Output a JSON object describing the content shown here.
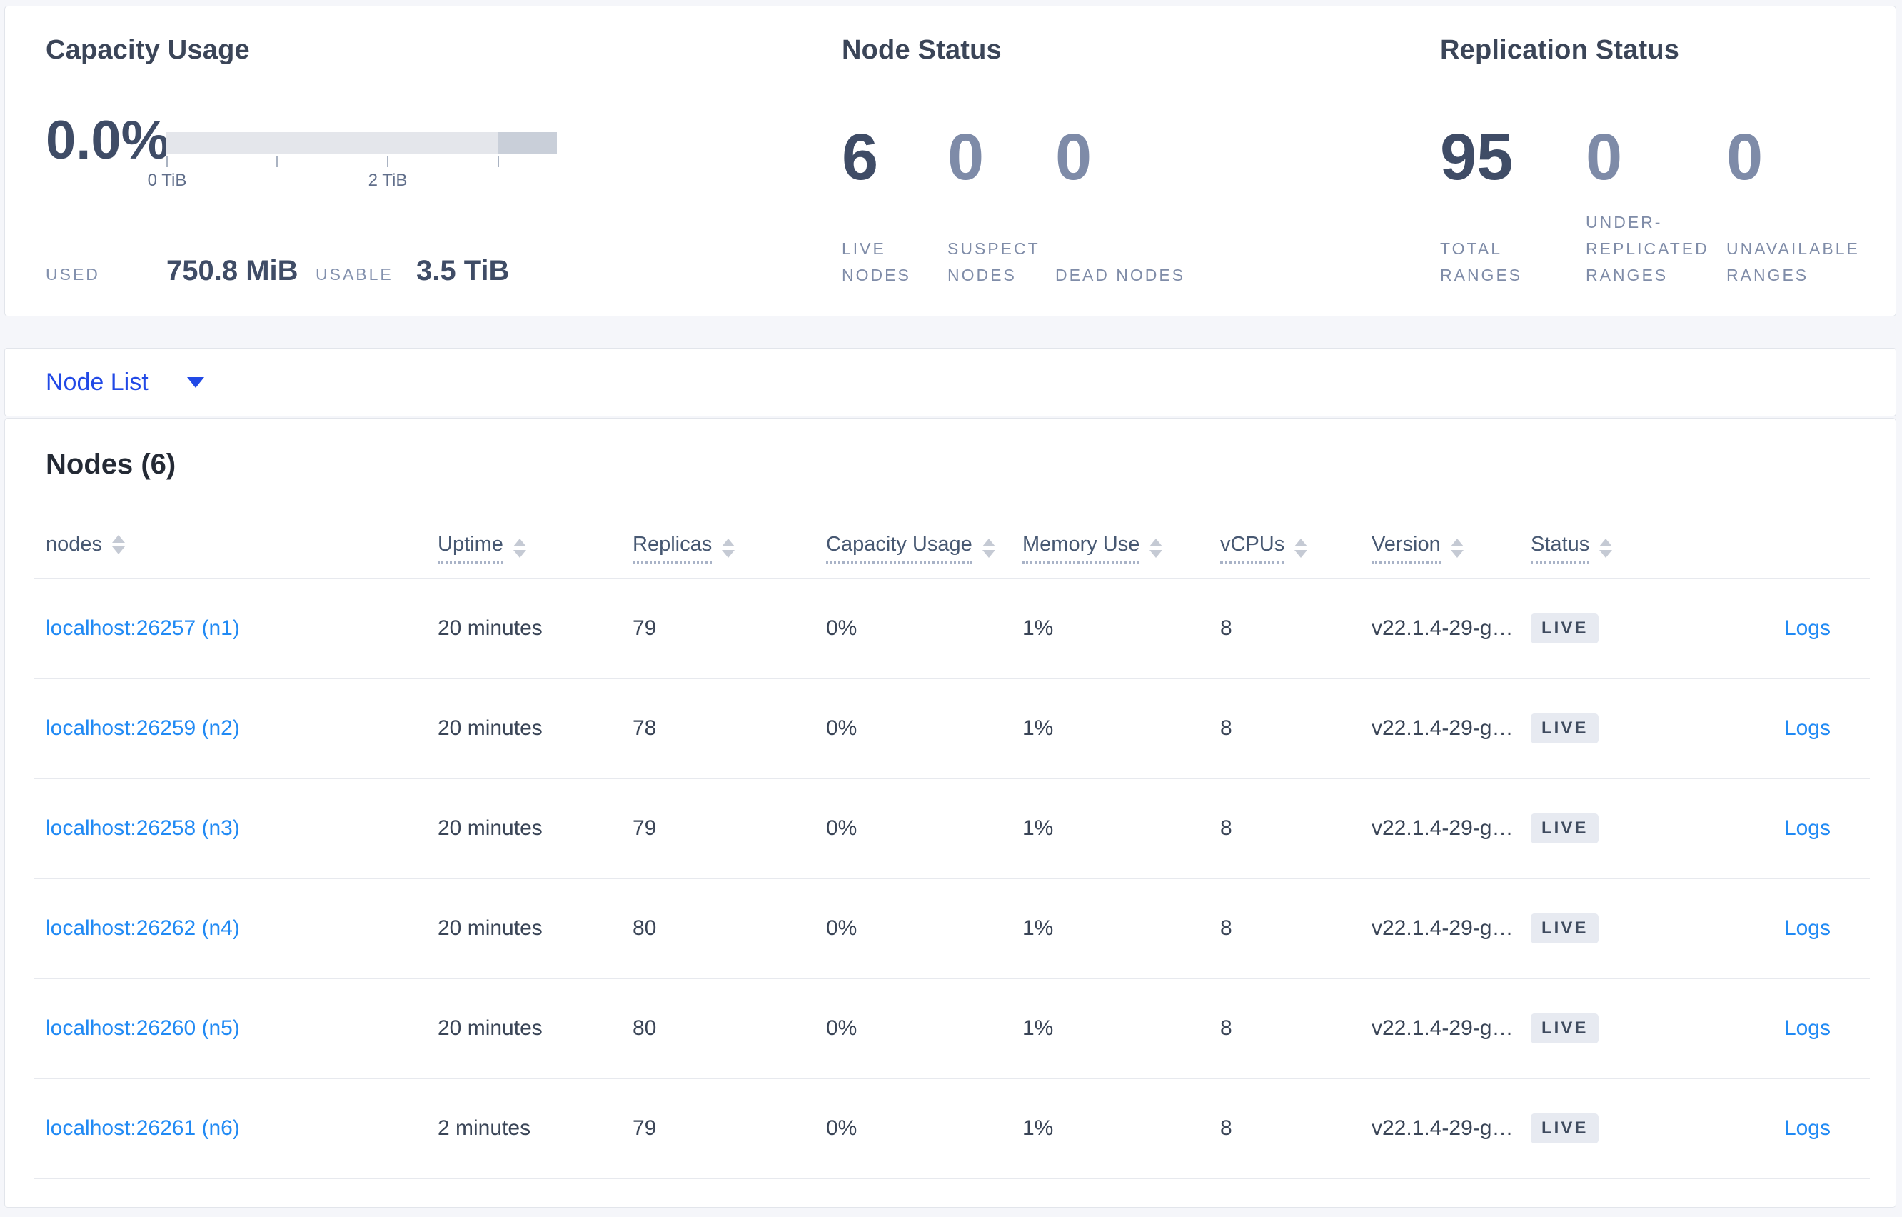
{
  "capacity": {
    "title": "Capacity Usage",
    "percent": "0.0%",
    "tick_labels": [
      "0 TiB",
      "2 TiB"
    ],
    "used_label": "USED",
    "used_value": "750.8 MiB",
    "usable_label": "USABLE",
    "usable_value": "3.5 TiB"
  },
  "node_status": {
    "title": "Node Status",
    "stats": [
      {
        "value": "6",
        "label": "LIVE NODES",
        "emphasis": "dark"
      },
      {
        "value": "0",
        "label": "SUSPECT NODES",
        "emphasis": "dim"
      },
      {
        "value": "0",
        "label": "DEAD NODES",
        "emphasis": "dim"
      }
    ]
  },
  "replication_status": {
    "title": "Replication Status",
    "stats": [
      {
        "value": "95",
        "label": "TOTAL RANGES",
        "emphasis": "dark"
      },
      {
        "value": "0",
        "label": "UNDER-REPLICATED RANGES",
        "emphasis": "dim"
      },
      {
        "value": "0",
        "label": "UNAVAILABLE RANGES",
        "emphasis": "dim"
      }
    ]
  },
  "view_selector": {
    "label": "Node List",
    "icon": "caret-down-icon"
  },
  "nodes_section": {
    "heading": "Nodes (6)",
    "columns": {
      "nodes": "nodes",
      "uptime": "Uptime",
      "replicas": "Replicas",
      "capacity": "Capacity Usage",
      "memory": "Memory Use",
      "vcpus": "vCPUs",
      "version": "Version",
      "status": "Status"
    },
    "rows": [
      {
        "node": "localhost:26257 (n1)",
        "uptime": "20 minutes",
        "replicas": "79",
        "capacity": "0%",
        "memory": "1%",
        "vcpus": "8",
        "version": "v22.1.4-29-g…",
        "status": "LIVE",
        "logs": "Logs"
      },
      {
        "node": "localhost:26259 (n2)",
        "uptime": "20 minutes",
        "replicas": "78",
        "capacity": "0%",
        "memory": "1%",
        "vcpus": "8",
        "version": "v22.1.4-29-g…",
        "status": "LIVE",
        "logs": "Logs"
      },
      {
        "node": "localhost:26258 (n3)",
        "uptime": "20 minutes",
        "replicas": "79",
        "capacity": "0%",
        "memory": "1%",
        "vcpus": "8",
        "version": "v22.1.4-29-g…",
        "status": "LIVE",
        "logs": "Logs"
      },
      {
        "node": "localhost:26262 (n4)",
        "uptime": "20 minutes",
        "replicas": "80",
        "capacity": "0%",
        "memory": "1%",
        "vcpus": "8",
        "version": "v22.1.4-29-g…",
        "status": "LIVE",
        "logs": "Logs"
      },
      {
        "node": "localhost:26260 (n5)",
        "uptime": "20 minutes",
        "replicas": "80",
        "capacity": "0%",
        "memory": "1%",
        "vcpus": "8",
        "version": "v22.1.4-29-g…",
        "status": "LIVE",
        "logs": "Logs"
      },
      {
        "node": "localhost:26261 (n6)",
        "uptime": "2 minutes",
        "replicas": "79",
        "capacity": "0%",
        "memory": "1%",
        "vcpus": "8",
        "version": "v22.1.4-29-g…",
        "status": "LIVE",
        "logs": "Logs"
      }
    ]
  },
  "colors": {
    "page_bg": "#f5f6fa",
    "card_border": "#e2e5eb",
    "heading": "#3b4558",
    "stat_dark": "#3f4c66",
    "stat_dim": "#7e8ba8",
    "stat_label": "#7f8ca8",
    "bar_track": "#e4e6eb",
    "bar_extra": "#c9cfd9",
    "selector_blue": "#2149e6",
    "link_blue": "#218af4",
    "badge_bg": "#e7eaf1",
    "row_divider": "#e7e9ee"
  }
}
